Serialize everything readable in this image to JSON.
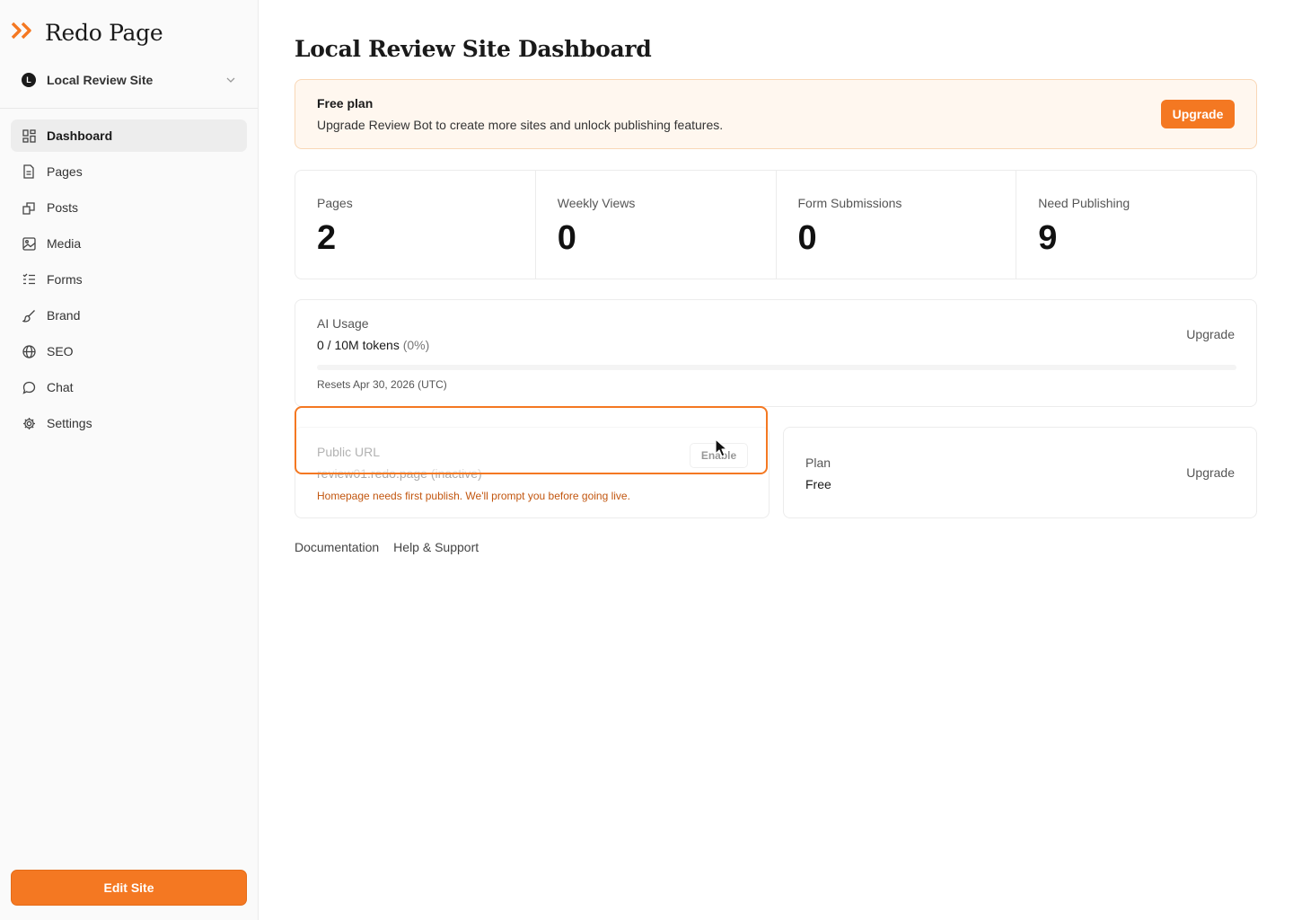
{
  "brand": {
    "name": "Redo Page",
    "accent": "#f47822"
  },
  "site_switcher": {
    "avatar_letter": "L",
    "site_name": "Local Review Site"
  },
  "sidebar": {
    "items": [
      {
        "label": "Dashboard",
        "icon": "dashboard-icon",
        "active": true
      },
      {
        "label": "Pages",
        "icon": "file-icon"
      },
      {
        "label": "Posts",
        "icon": "posts-icon"
      },
      {
        "label": "Media",
        "icon": "image-icon"
      },
      {
        "label": "Forms",
        "icon": "list-icon"
      },
      {
        "label": "Brand",
        "icon": "brush-icon"
      },
      {
        "label": "SEO",
        "icon": "globe-icon"
      },
      {
        "label": "Chat",
        "icon": "chat-icon"
      },
      {
        "label": "Settings",
        "icon": "gear-icon"
      }
    ],
    "edit_site_label": "Edit Site"
  },
  "main": {
    "title": "Local Review Site Dashboard",
    "plan_banner": {
      "title": "Free plan",
      "description": "Upgrade Review Bot to create more sites and unlock publishing features.",
      "button_label": "Upgrade"
    },
    "stats": [
      {
        "label": "Pages",
        "value": "2"
      },
      {
        "label": "Weekly Views",
        "value": "0"
      },
      {
        "label": "Form Submissions",
        "value": "0"
      },
      {
        "label": "Need Publishing",
        "value": "9"
      }
    ],
    "ai_usage": {
      "label": "AI Usage",
      "usage_text": "0 / 10M tokens",
      "percent_text": "(0%)",
      "progress_fraction": 0,
      "resets_text": "Resets Apr 30, 2026 (UTC)",
      "upgrade_label": "Upgrade"
    },
    "public_url": {
      "label": "Public URL",
      "url_text": "review01.redo.page (inactive)",
      "warning": "Homepage needs first publish. We'll prompt you before going live.",
      "enable_label": "Enable"
    },
    "plan": {
      "label": "Plan",
      "value": "Free",
      "upgrade_label": "Upgrade"
    },
    "footer_links": [
      "Documentation",
      "Help & Support"
    ]
  }
}
